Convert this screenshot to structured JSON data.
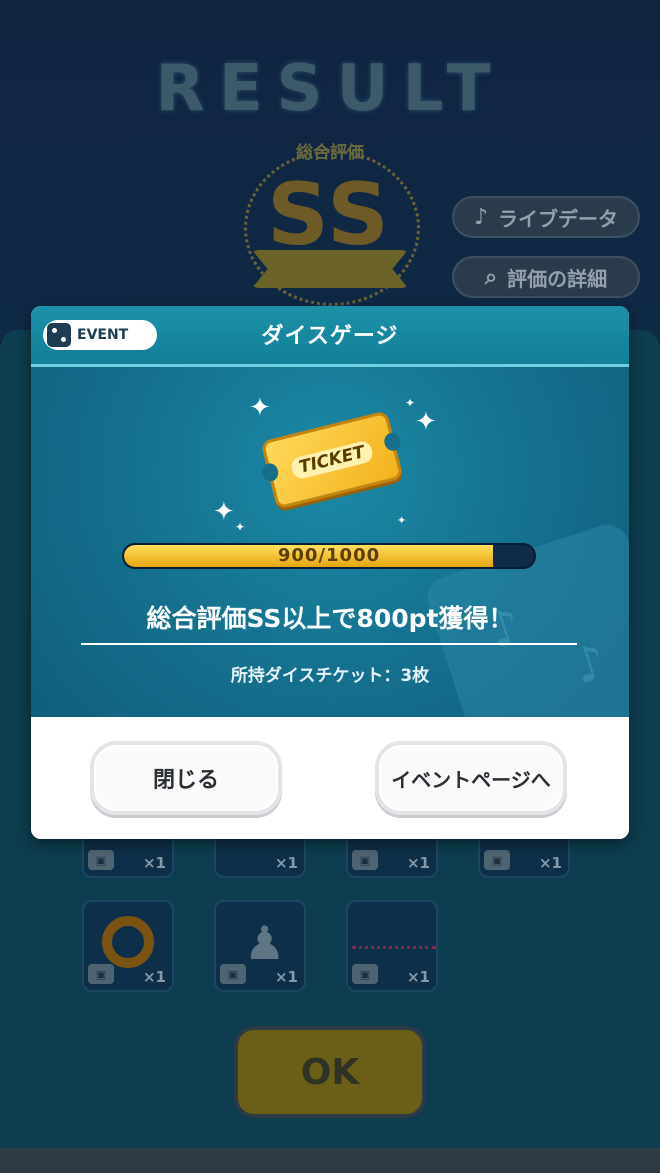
{
  "background": {
    "result_title": "RESULT",
    "overall_eval_label": "総合評価",
    "rank": "SS",
    "side_buttons": {
      "live_data": "ライブデータ",
      "eval_details": "評価の詳細"
    },
    "reward_tiles": [
      {
        "qty": "×1"
      },
      {
        "qty": "×1"
      },
      {
        "qty": "×1"
      },
      {
        "qty": "×1"
      },
      {
        "qty": "×1"
      },
      {
        "qty": "×1"
      },
      {
        "qty": "×1"
      }
    ],
    "ok_label": "OK"
  },
  "modal": {
    "badge": "EVENT",
    "title": "ダイスゲージ",
    "ticket_label": "TICKET",
    "progress": {
      "current": 900,
      "max": 1000,
      "text": "900/1000"
    },
    "bonus_message": "総合評価SS以上で800pt獲得！",
    "ticket_count": "所持ダイスチケット：3枚",
    "buttons": {
      "close": "閉じる",
      "event_page": "イベントページへ"
    }
  },
  "colors": {
    "modal_header": "#1c91a8",
    "progress_fill": "#f3c02a",
    "rank_gold": "#6e5a26"
  }
}
